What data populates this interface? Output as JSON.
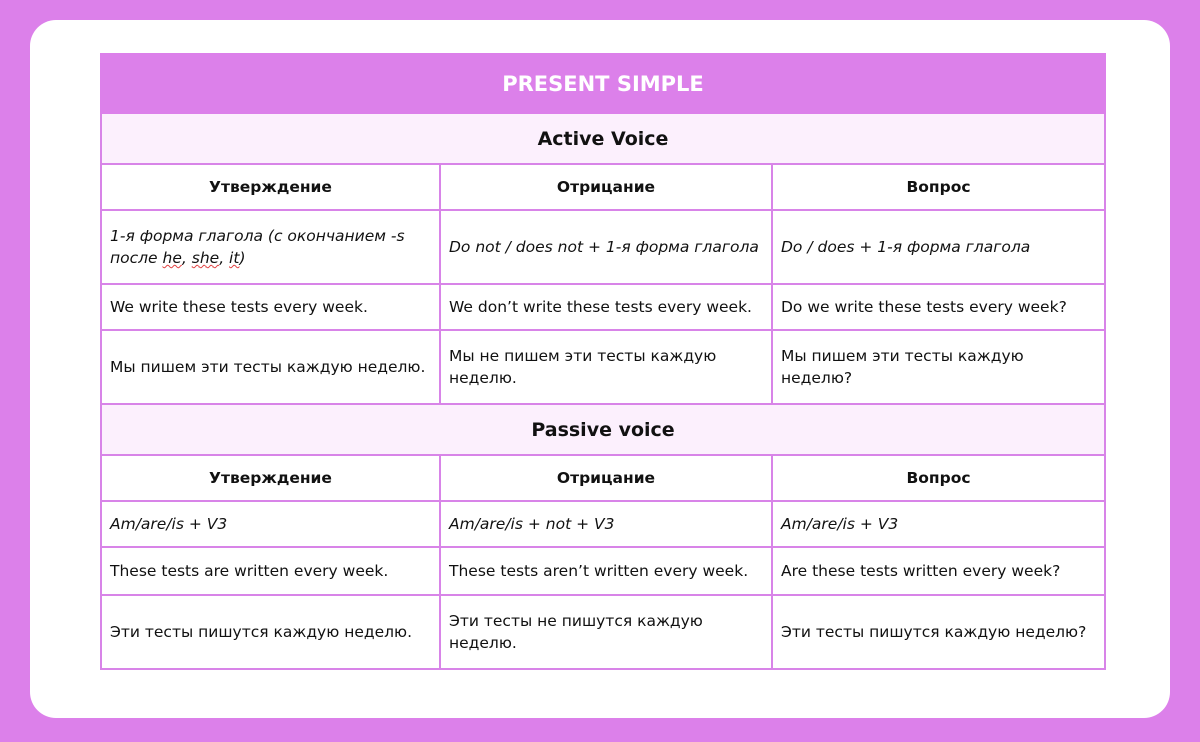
{
  "title": "PRESENT SIMPLE",
  "sections": [
    {
      "name": "Active Voice",
      "headers": [
        "Утверждение",
        "Отрицание",
        "Вопрос"
      ],
      "rows": [
        {
          "type": "formula",
          "cells": [
            "1-я форма глагола (с окончанием -s после he, she, it)",
            "Do not / does not + 1-я форма глагола",
            "Do / does + 1-я форма глагола"
          ],
          "height": 74
        },
        {
          "type": "example",
          "cells": [
            "We write these tests every week.",
            "We don’t write these tests every week.",
            "Do we write these tests every week?"
          ],
          "height": 46
        },
        {
          "type": "translation",
          "cells": [
            "Мы пишем эти тесты каждую неделю.",
            "Мы не пишем эти тесты каждую неделю.",
            "Мы пишем эти тесты каждую неделю?"
          ],
          "height": 74
        }
      ]
    },
    {
      "name": "Passive voice",
      "headers": [
        "Утверждение",
        "Отрицание",
        "Вопрос"
      ],
      "rows": [
        {
          "type": "formula",
          "cells": [
            "Am/are/is + V3",
            "Am/are/is + not + V3",
            "Am/are/is + V3"
          ],
          "height": 46
        },
        {
          "type": "example",
          "cells": [
            "These tests are written every week.",
            "These tests aren’t written every week.",
            "Are these tests written every week?"
          ],
          "height": 48
        },
        {
          "type": "translation",
          "cells": [
            "Эти тесты пишутся каждую неделю.",
            "Эти тесты не пишутся каждую неделю.",
            "Эти тесты пишутся каждую неделю?"
          ],
          "height": 74
        }
      ]
    }
  ]
}
